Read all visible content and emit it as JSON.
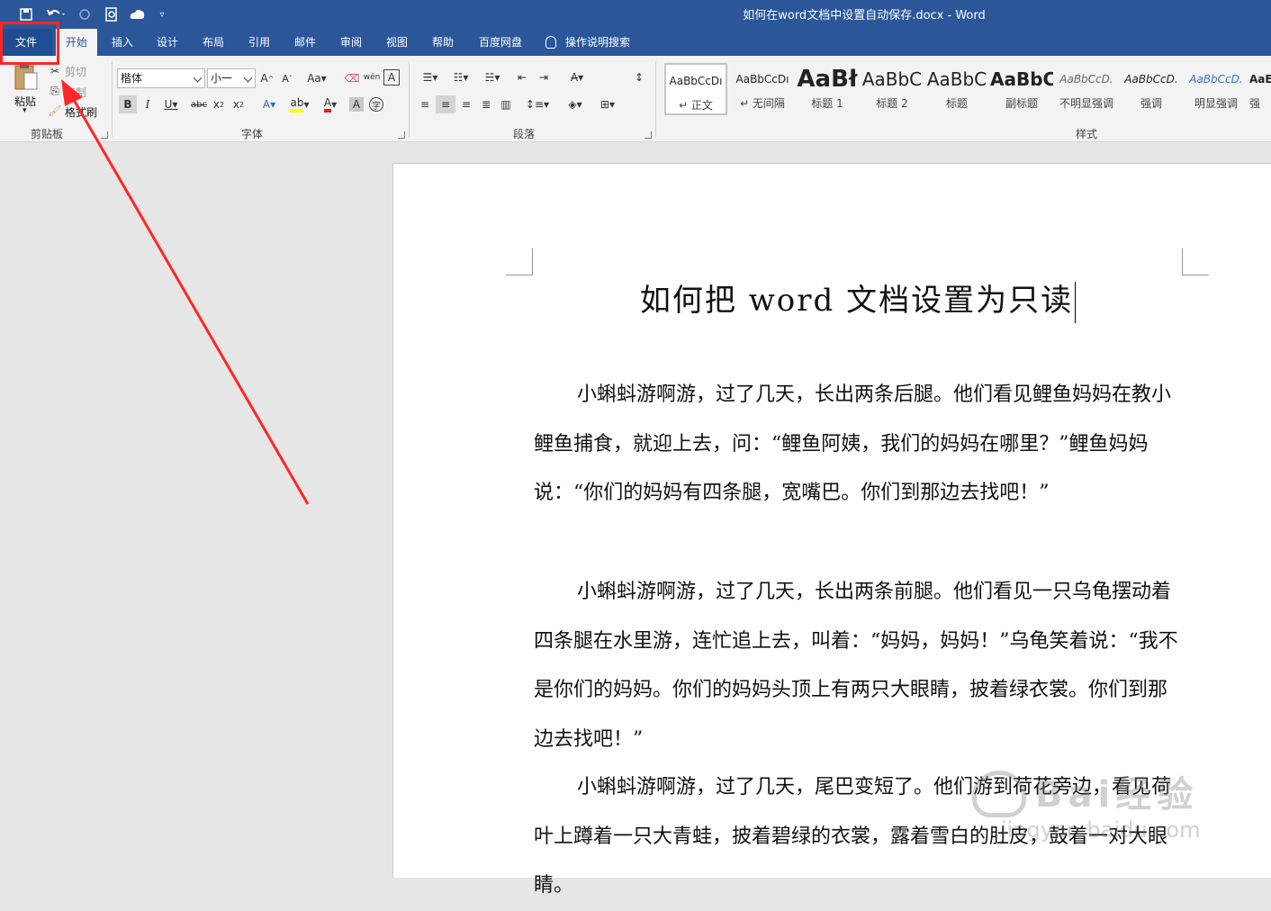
{
  "window": {
    "title": "如何在word文档中设置自动保存.docx  -  Word"
  },
  "tabs": {
    "file": "文件",
    "home": "开始",
    "insert": "插入",
    "design": "设计",
    "layout": "布局",
    "references": "引用",
    "mailings": "邮件",
    "review": "审阅",
    "view": "视图",
    "help": "帮助",
    "baidu": "百度网盘",
    "tell_me": "操作说明搜索"
  },
  "clipboard": {
    "paste": "粘贴",
    "cut": "剪切",
    "copy": "复制",
    "format_painter": "格式刷",
    "group": "剪贴板"
  },
  "font": {
    "name": "楷体",
    "size": "小一",
    "group": "字体"
  },
  "paragraph": {
    "group": "段落"
  },
  "styles": {
    "group": "样式",
    "items": [
      {
        "preview": "AaBbCcDı",
        "name": "↵ 正文"
      },
      {
        "preview": "AaBbCcDı",
        "name": "↵ 无间隔"
      },
      {
        "preview": "AaBł",
        "name": "标题 1"
      },
      {
        "preview": "AaBbC",
        "name": "标题 2"
      },
      {
        "preview": "AaBbC",
        "name": "标题"
      },
      {
        "preview": "AaBbC",
        "name": "副标题"
      },
      {
        "preview": "AaBbCcD.",
        "name": "不明显强调"
      },
      {
        "preview": "AaBbCcD.",
        "name": "强调"
      },
      {
        "preview": "AaBbCcD.",
        "name": "明显强调"
      },
      {
        "preview": "AaE",
        "name": "强"
      }
    ]
  },
  "document": {
    "heading": "如何把 word 文档设置为只读",
    "paragraphs": [
      "小蝌蚪游啊游，过了几天，长出两条后腿。他们看见鲤鱼妈妈在教小鲤鱼捕食，就迎上去，问：“鲤鱼阿姨，我们的妈妈在哪里？”鲤鱼妈妈说：“你们的妈妈有四条腿，宽嘴巴。你们到那边去找吧！”",
      "小蝌蚪游啊游，过了几天，长出两条前腿。他们看见一只乌龟摆动着四条腿在水里游，连忙追上去，叫着：“妈妈，妈妈！”乌龟笑着说：“我不是你们的妈妈。你们的妈妈头顶上有两只大眼睛，披着绿衣裳。你们到那边去找吧！”",
      "小蝌蚪游啊游，过了几天，尾巴变短了。他们游到荷花旁边，看见荷叶上蹲着一只大青蛙，披着碧绿的衣裳，露着雪白的肚皮，鼓着一对大眼睛。"
    ]
  },
  "watermark": {
    "main": "Bai经验",
    "sub": "jingyan.baidu.com"
  },
  "colors": {
    "ribbon_blue": "#2b579a",
    "annotation_red": "#ff2626"
  }
}
